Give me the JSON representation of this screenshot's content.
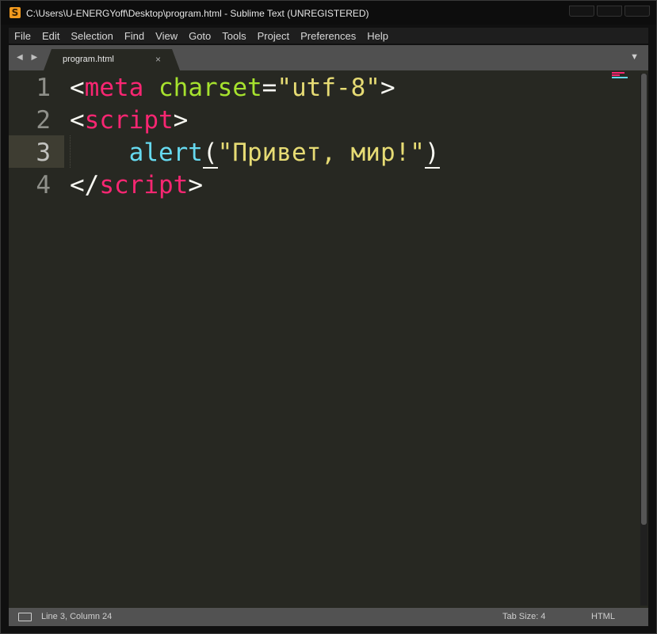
{
  "window": {
    "title": "C:\\Users\\U-ENERGYoff\\Desktop\\program.html - Sublime Text (UNREGISTERED)",
    "app_icon_glyph": "S"
  },
  "menu": [
    "File",
    "Edit",
    "Selection",
    "Find",
    "View",
    "Goto",
    "Tools",
    "Project",
    "Preferences",
    "Help"
  ],
  "tabs": {
    "nav_arrows": "◀ ▶",
    "active_tab": "program.html",
    "close_glyph": "×",
    "dropdown_glyph": "▼"
  },
  "editor": {
    "current_line": 3,
    "line_numbers": [
      "1",
      "2",
      "3",
      "4"
    ],
    "lines": [
      [
        {
          "t": "<",
          "c": "white"
        },
        {
          "t": "meta",
          "c": "pink"
        },
        {
          "t": " ",
          "c": "white"
        },
        {
          "t": "charset",
          "c": "green"
        },
        {
          "t": "=",
          "c": "white"
        },
        {
          "t": "\"utf-8\"",
          "c": "yellow"
        },
        {
          "t": ">",
          "c": "white"
        }
      ],
      [
        {
          "t": "<",
          "c": "white"
        },
        {
          "t": "script",
          "c": "pink"
        },
        {
          "t": ">",
          "c": "white"
        }
      ],
      [
        {
          "t": "    ",
          "c": "white"
        },
        {
          "t": "alert",
          "c": "cyan"
        },
        {
          "t": "(",
          "c": "white",
          "bracket": true
        },
        {
          "t": "\"Привет, мир!\"",
          "c": "yellow"
        },
        {
          "t": ")",
          "c": "white",
          "bracket": true
        }
      ],
      [
        {
          "t": "</",
          "c": "white"
        },
        {
          "t": "script",
          "c": "pink"
        },
        {
          "t": ">",
          "c": "white"
        }
      ]
    ],
    "colors": {
      "background": "#272822",
      "white": "#f8f8f2",
      "pink": "#f92672",
      "green": "#a6e22e",
      "yellow": "#e6db74",
      "cyan": "#66d9ef"
    }
  },
  "status": {
    "position": "Line 3, Column 24",
    "tab_size": "Tab Size: 4",
    "syntax": "HTML"
  }
}
